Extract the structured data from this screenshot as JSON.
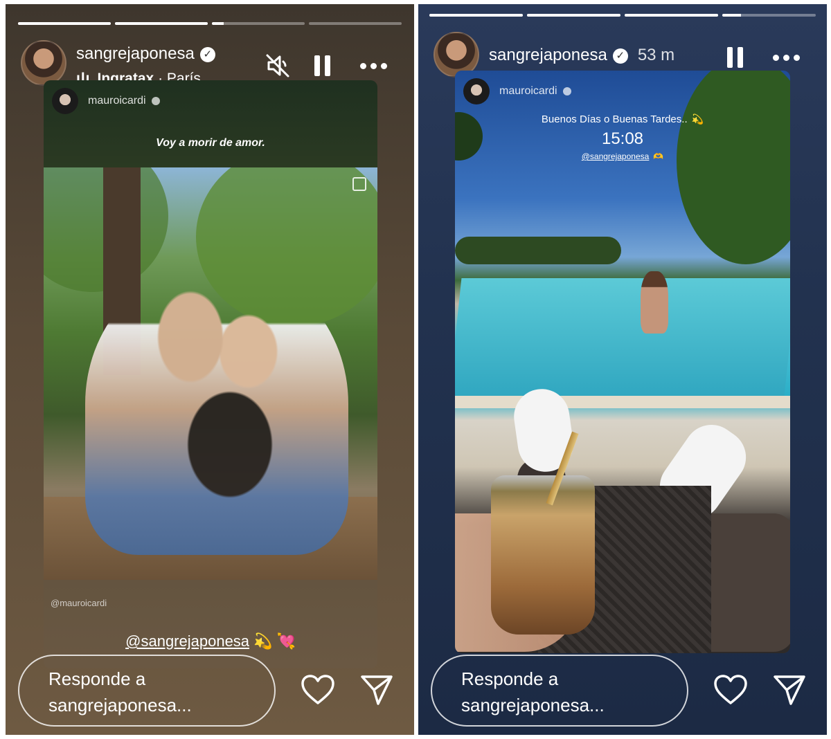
{
  "left_story": {
    "progress": [
      1,
      1,
      0.13,
      0
    ],
    "username": "sangrejaponesa",
    "music": {
      "bars": "ılı",
      "song": "Ingratax",
      "artist": "· París"
    },
    "icons": [
      "verified-icon",
      "mute-icon",
      "pause-icon",
      "more-icon"
    ],
    "card": {
      "author": "mauroicardi",
      "caption": "Voy a morir de amor.",
      "credit": "@mauroicardi",
      "mention": "@sangrejaponesa",
      "emoji": [
        "💫",
        "💘"
      ]
    },
    "reply_placeholder": "Responde a\nsangrejaponesa...",
    "reply_line1": "Responde a",
    "reply_line2": "sangrejaponesa..."
  },
  "right_story": {
    "progress": [
      1,
      1,
      1,
      0.2
    ],
    "username": "sangrejaponesa",
    "time_ago": "53 m",
    "card": {
      "author": "mauroicardi",
      "greeting": "Buenos Días o Buenas Tardes..",
      "time": "15:08",
      "mention": "@sangrejaponesa",
      "emoji": [
        "💫",
        "🫶"
      ]
    },
    "reply_line1": "Responde a",
    "reply_line2": "sangrejaponesa..."
  },
  "colors": {
    "accent": "#ffffff",
    "left_bg": "#5a4a38",
    "right_bg": "#22324f"
  }
}
